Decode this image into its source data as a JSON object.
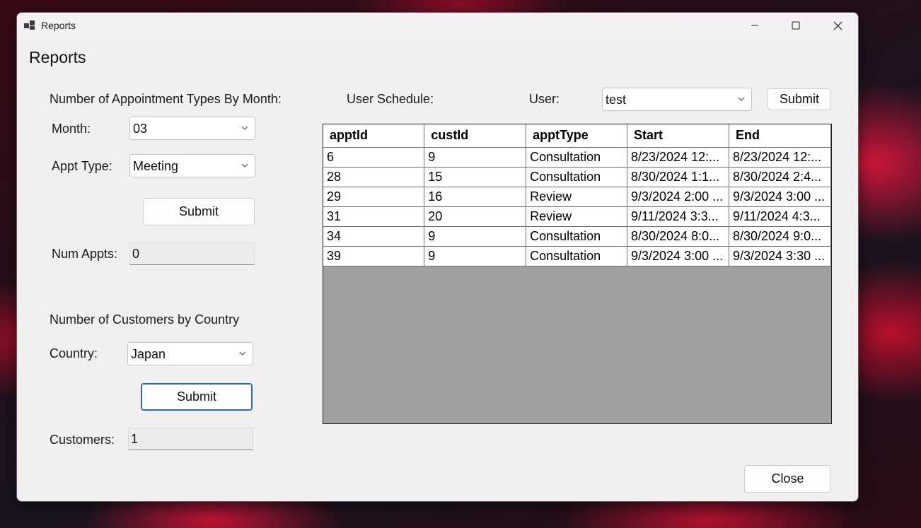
{
  "window": {
    "title": "Reports"
  },
  "form": {
    "heading": "Reports"
  },
  "appt_section": {
    "title": "Number of Appointment Types By Month:",
    "month_label": "Month:",
    "month_value": "03",
    "appt_type_label": "Appt Type:",
    "appt_type_value": "Meeting",
    "submit_label": "Submit",
    "num_appts_label": "Num Appts:",
    "num_appts_value": "0"
  },
  "customer_section": {
    "title": "Number of Customers by Country",
    "country_label": "Country:",
    "country_value": "Japan",
    "submit_label": "Submit",
    "customers_label": "Customers:",
    "customers_value": "1"
  },
  "schedule_section": {
    "title": "User Schedule:",
    "user_label": "User:",
    "user_value": "test",
    "submit_label": "Submit",
    "columns": [
      "apptId",
      "custId",
      "apptType",
      "Start",
      "End"
    ],
    "rows": [
      [
        "6",
        "9",
        "Consultation",
        "8/23/2024 12:...",
        "8/23/2024 12:..."
      ],
      [
        "28",
        "15",
        "Consultation",
        "8/30/2024 1:1...",
        "8/30/2024 2:4..."
      ],
      [
        "29",
        "16",
        "Review",
        "9/3/2024 2:00 ...",
        "9/3/2024 3:00 ..."
      ],
      [
        "31",
        "20",
        "Review",
        "9/11/2024 3:3...",
        "9/11/2024 4:3..."
      ],
      [
        "34",
        "9",
        "Consultation",
        "8/30/2024 8:0...",
        "8/30/2024 9:0..."
      ],
      [
        "39",
        "9",
        "Consultation",
        "9/3/2024 3:00 ...",
        "9/3/2024 3:30 ..."
      ]
    ]
  },
  "footer": {
    "close_label": "Close"
  }
}
